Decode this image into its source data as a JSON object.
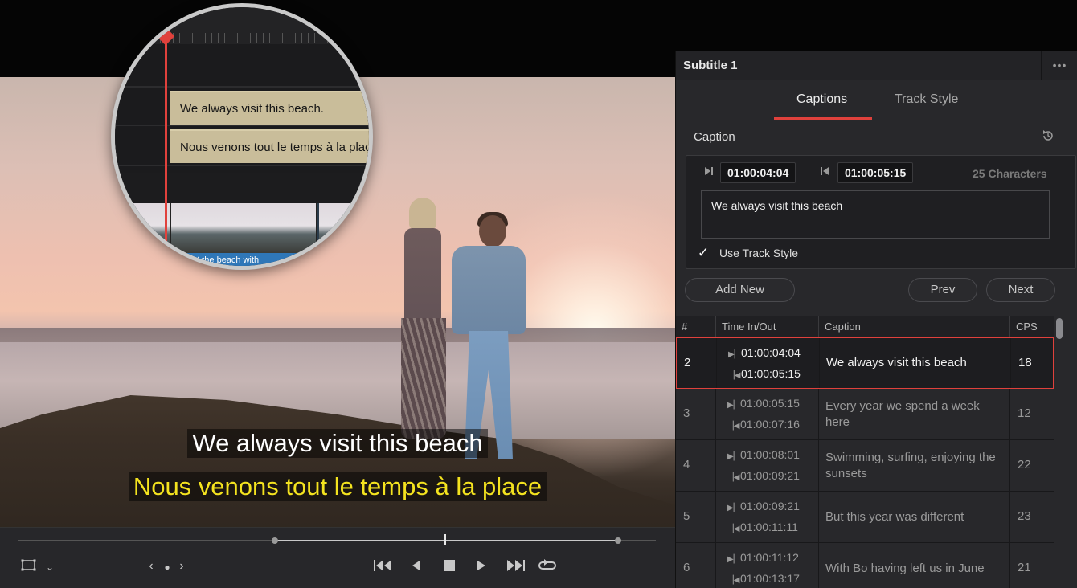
{
  "viewer": {
    "subtitle_primary": "We always visit this beach",
    "subtitle_secondary": "Nous venons tout le temps à la place"
  },
  "zoom": {
    "clip_top": "We always visit this beach.",
    "clip_bottom": "Nous venons tout le temps à la place",
    "audio_label": "at the beach with"
  },
  "transport": {
    "buttons": {
      "safe_area": "safe-area-icon",
      "jump_start": "jump-to-start-icon",
      "reverse": "play-reverse-icon",
      "stop": "stop-icon",
      "play": "play-icon",
      "jump_end": "jump-to-end-icon",
      "loop": "loop-icon"
    }
  },
  "panel": {
    "title": "Subtitle 1",
    "more": "•••",
    "tabs": [
      "Captions",
      "Track Style"
    ],
    "section_label": "Caption",
    "time_in": "01:00:04:04",
    "time_out": "01:00:05:15",
    "char_count": "25 Characters",
    "caption_text": "We always visit this beach",
    "use_track_style": "Use Track Style",
    "add_new": "Add New",
    "prev": "Prev",
    "next": "Next"
  },
  "table": {
    "headers": [
      "#",
      "Time In/Out",
      "Caption",
      "CPS"
    ],
    "rows": [
      {
        "num": "2",
        "in": "01:00:04:04",
        "out": "01:00:05:15",
        "caption": "We always visit this beach",
        "cps": "18"
      },
      {
        "num": "3",
        "in": "01:00:05:15",
        "out": "01:00:07:16",
        "caption": "Every year we spend a week here",
        "cps": "12"
      },
      {
        "num": "4",
        "in": "01:00:08:01",
        "out": "01:00:09:21",
        "caption": "Swimming, surfing, enjoying the sunsets",
        "cps": "22"
      },
      {
        "num": "5",
        "in": "01:00:09:21",
        "out": "01:00:11:11",
        "caption": "But this year was different",
        "cps": "23"
      },
      {
        "num": "6",
        "in": "01:00:11:12",
        "out": "01:00:13:17",
        "caption": "With Bo having left us in June",
        "cps": "21"
      }
    ]
  },
  "colors": {
    "accent": "#e0413c",
    "subtitle_secondary": "#f4e31f",
    "clip": "#c9bd9a",
    "audio": "#2f77b8"
  }
}
